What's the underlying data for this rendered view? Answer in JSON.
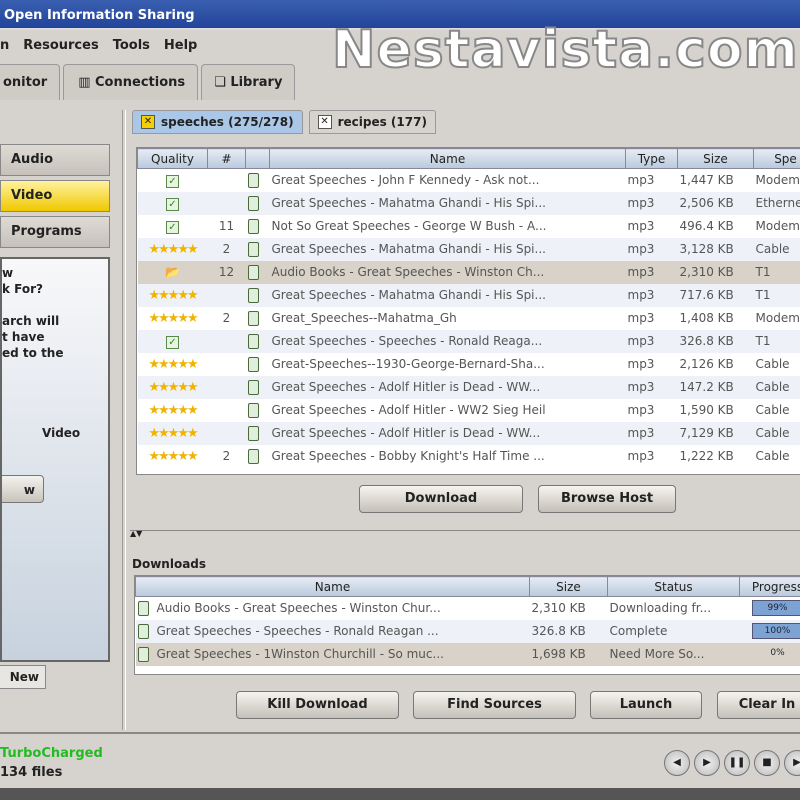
{
  "window": {
    "title": "Open Information Sharing"
  },
  "watermark": "Nestavista.com",
  "menu": [
    "n",
    "Resources",
    "Tools",
    "Help"
  ],
  "main_tabs": [
    "onitor",
    "Connections",
    "Library"
  ],
  "categories": [
    {
      "label": "Audio",
      "selected": false
    },
    {
      "label": "Video",
      "selected": true
    },
    {
      "label": "Programs",
      "selected": false
    }
  ],
  "info_box": {
    "lines": [
      "w",
      "k For?",
      "",
      "arch will",
      "t have",
      "ed to the",
      "",
      "",
      "",
      "Video"
    ],
    "button": "w"
  },
  "new_button": "New",
  "search_tabs": [
    {
      "label": "speeches (275/278)",
      "selected": true
    },
    {
      "label": "recipes (177)",
      "selected": false
    }
  ],
  "results": {
    "columns": [
      "Quality",
      "#",
      "",
      "Name",
      "Type",
      "Size",
      "Spe"
    ],
    "rows": [
      {
        "quality": "check",
        "count": "",
        "name": "Great Speeches - John F Kennedy - Ask not...",
        "type": "mp3",
        "size": "1,447 KB",
        "speed": "Modem"
      },
      {
        "quality": "check",
        "count": "",
        "name": "Great Speeches - Mahatma Ghandi - His Spi...",
        "type": "mp3",
        "size": "2,506 KB",
        "speed": "Ethernet"
      },
      {
        "quality": "check",
        "count": "11",
        "name": "Not So Great Speeches - George W Bush - A...",
        "type": "mp3",
        "size": "496.4 KB",
        "speed": "Modem"
      },
      {
        "quality": "stars",
        "count": "2",
        "name": "Great Speeches - Mahatma Ghandi - His Spi...",
        "type": "mp3",
        "size": "3,128 KB",
        "speed": "Cable"
      },
      {
        "quality": "folder",
        "count": "12",
        "name": "Audio Books - Great Speeches - Winston Ch...",
        "type": "mp3",
        "size": "2,310 KB",
        "speed": "T1",
        "highlight": true
      },
      {
        "quality": "stars",
        "count": "",
        "name": "Great Speeches - Mahatma Ghandi - His Spi...",
        "type": "mp3",
        "size": "717.6 KB",
        "speed": "T1"
      },
      {
        "quality": "stars",
        "count": "2",
        "name": "Great_Speeches--Mahatma_Gh",
        "type": "mp3",
        "size": "1,408 KB",
        "speed": "Modem"
      },
      {
        "quality": "check",
        "count": "",
        "name": "Great Speeches - Speeches - Ronald Reaga...",
        "type": "mp3",
        "size": "326.8 KB",
        "speed": "T1"
      },
      {
        "quality": "stars",
        "count": "",
        "name": "Great-Speeches--1930-George-Bernard-Sha...",
        "type": "mp3",
        "size": "2,126 KB",
        "speed": "Cable"
      },
      {
        "quality": "stars",
        "count": "",
        "name": "Great Speeches - Adolf Hitler is Dead - WW...",
        "type": "mp3",
        "size": "147.2 KB",
        "speed": "Cable"
      },
      {
        "quality": "stars",
        "count": "",
        "name": "Great Speeches - Adolf Hitler - WW2 Sieg Heil",
        "type": "mp3",
        "size": "1,590 KB",
        "speed": "Cable"
      },
      {
        "quality": "stars",
        "count": "",
        "name": "Great Speeches - Adolf Hitler is Dead - WW...",
        "type": "mp3",
        "size": "7,129 KB",
        "speed": "Cable"
      },
      {
        "quality": "stars",
        "count": "2",
        "name": "Great Speeches - Bobby Knight's Half Time ...",
        "type": "mp3",
        "size": "1,222 KB",
        "speed": "Cable"
      }
    ]
  },
  "result_buttons": {
    "download": "Download",
    "browse_host": "Browse Host"
  },
  "downloads": {
    "label": "Downloads",
    "columns": [
      "Name",
      "Size",
      "Status",
      "Progress"
    ],
    "rows": [
      {
        "name": "Audio Books - Great Speeches - Winston Chur...",
        "size": "2,310 KB",
        "status": "Downloading fr...",
        "progress": "99%",
        "pct": 99
      },
      {
        "name": "Great Speeches - Speeches - Ronald Reagan ...",
        "size": "326.8 KB",
        "status": "Complete",
        "progress": "100%",
        "pct": 100
      },
      {
        "name": "Great Speeches - 1Winston Churchill - So muc...",
        "size": "1,698 KB",
        "status": "Need More So...",
        "progress": "0%",
        "pct": 0
      }
    ]
  },
  "download_buttons": {
    "kill": "Kill Download",
    "find": "Find Sources",
    "launch": "Launch",
    "clear": "Clear In"
  },
  "status": {
    "turbo": "TurboCharged",
    "files": "134 files",
    "turbo_color": "#22bb22"
  }
}
